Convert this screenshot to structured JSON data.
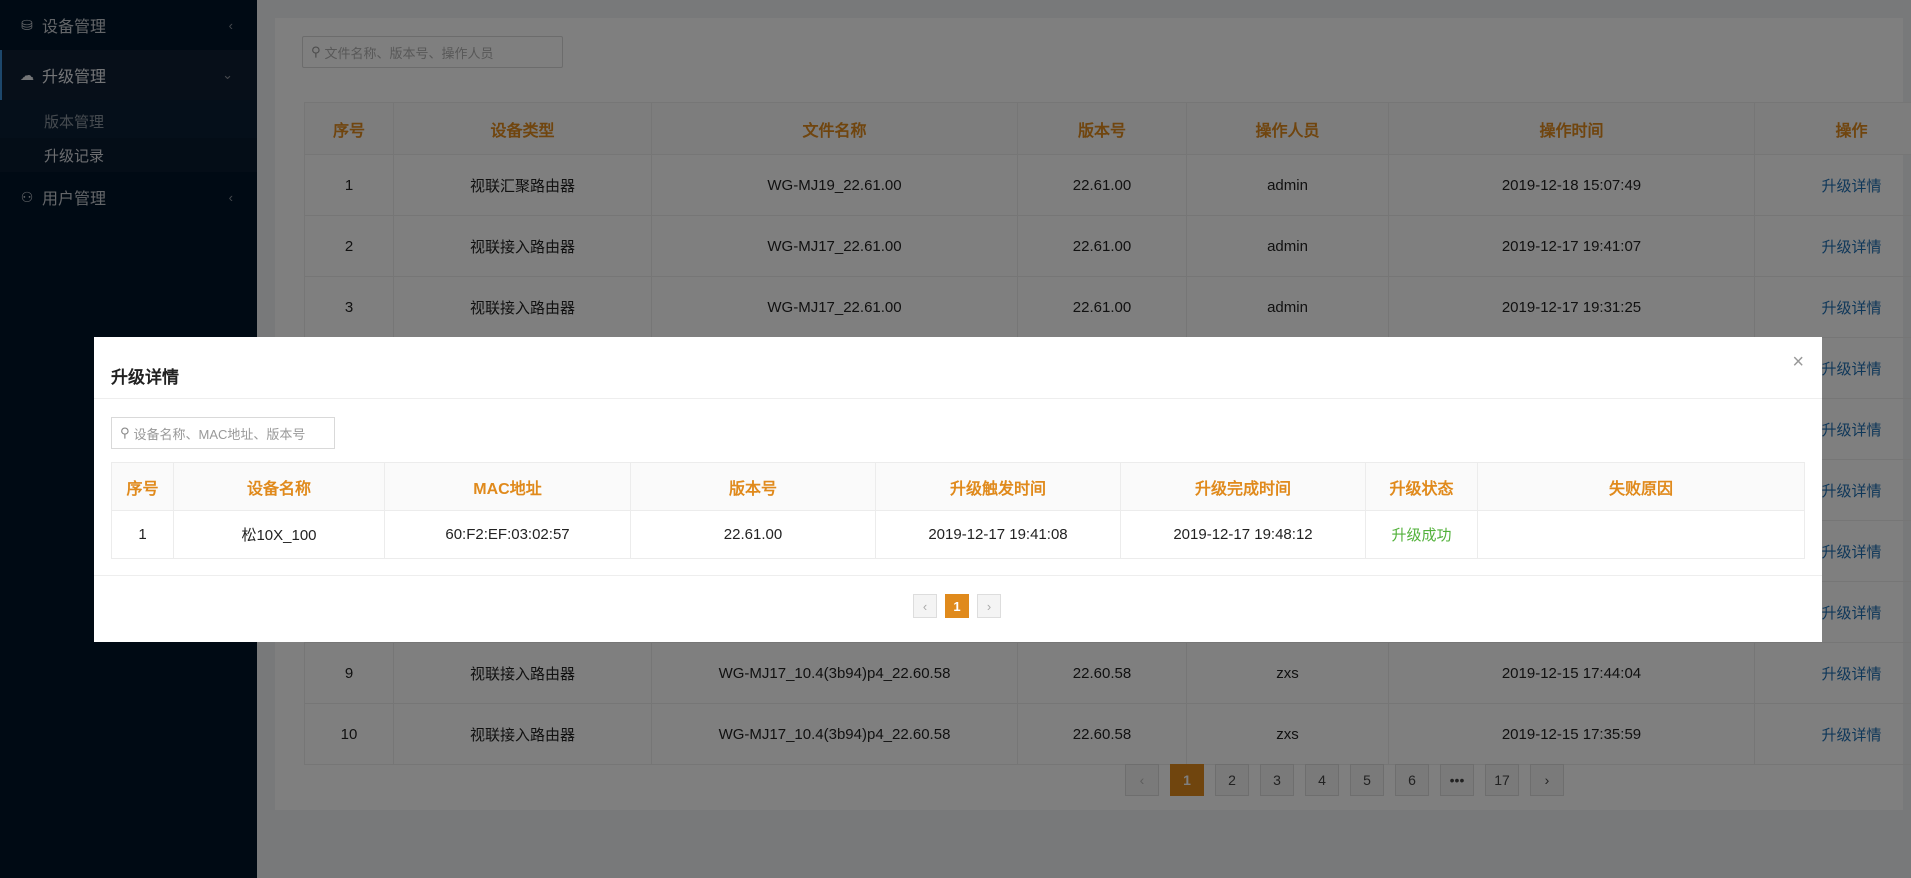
{
  "sidebar": {
    "items": [
      {
        "label": "设备管理",
        "icon": "device-icon"
      },
      {
        "label": "升级管理",
        "icon": "cloud-upload-icon"
      },
      {
        "label": "用户管理",
        "icon": "user-edit-icon"
      }
    ],
    "sub_items": [
      {
        "label": "版本管理"
      },
      {
        "label": "升级记录"
      }
    ]
  },
  "main": {
    "search_placeholder": "文件名称、版本号、操作人员",
    "columns": [
      "序号",
      "设备类型",
      "文件名称",
      "版本号",
      "操作人员",
      "操作时间",
      "操作"
    ],
    "rows": [
      {
        "no": "1",
        "type": "视联汇聚路由器",
        "file": "WG-MJ19_22.61.00",
        "version": "22.61.00",
        "operator": "admin",
        "time": "2019-12-18 15:07:49",
        "action": "升级详情"
      },
      {
        "no": "2",
        "type": "视联接入路由器",
        "file": "WG-MJ17_22.61.00",
        "version": "22.61.00",
        "operator": "admin",
        "time": "2019-12-17 19:41:07",
        "action": "升级详情"
      },
      {
        "no": "3",
        "type": "视联接入路由器",
        "file": "WG-MJ17_22.61.00",
        "version": "22.61.00",
        "operator": "admin",
        "time": "2019-12-17 19:31:25",
        "action": "升级详情"
      },
      {
        "no": "",
        "type": "",
        "file": "",
        "version": "",
        "operator": "",
        "time": "",
        "action": "升级详情"
      },
      {
        "no": "",
        "type": "",
        "file": "",
        "version": "",
        "operator": "",
        "time": "",
        "action": "升级详情"
      },
      {
        "no": "",
        "type": "",
        "file": "",
        "version": "",
        "operator": "",
        "time": "",
        "action": "升级详情"
      },
      {
        "no": "",
        "type": "",
        "file": "",
        "version": "",
        "operator": "",
        "time": "",
        "action": "升级详情"
      },
      {
        "no": "",
        "type": "",
        "file": "",
        "version": "",
        "operator": "",
        "time": "",
        "action": "升级详情"
      },
      {
        "no": "9",
        "type": "视联接入路由器",
        "file": "WG-MJ17_10.4(3b94)p4_22.60.58",
        "version": "22.60.58",
        "operator": "zxs",
        "time": "2019-12-15 17:44:04",
        "action": "升级详情"
      },
      {
        "no": "10",
        "type": "视联接入路由器",
        "file": "WG-MJ17_10.4(3b94)p4_22.60.58",
        "version": "22.60.58",
        "operator": "zxs",
        "time": "2019-12-15 17:35:59",
        "action": "升级详情"
      }
    ],
    "pagination": {
      "prev": "‹",
      "pages": [
        "1",
        "2",
        "3",
        "4",
        "5",
        "6",
        "•••",
        "17"
      ],
      "current": "1",
      "next": "›"
    }
  },
  "modal": {
    "title": "升级详情",
    "close": "×",
    "search_placeholder": "设备名称、MAC地址、版本号",
    "columns": [
      "序号",
      "设备名称",
      "MAC地址",
      "版本号",
      "升级触发时间",
      "升级完成时间",
      "升级状态",
      "失败原因"
    ],
    "rows": [
      {
        "no": "1",
        "name": "松10X_100",
        "mac": "60:F2:EF:03:02:57",
        "version": "22.61.00",
        "trigger_time": "2019-12-17 19:41:08",
        "done_time": "2019-12-17 19:48:12",
        "status": "升级成功",
        "reason": ""
      }
    ],
    "pagination": {
      "prev": "‹",
      "current": "1",
      "next": "›"
    }
  },
  "colors": {
    "accent": "#e08a1c",
    "link": "#1f6fb3",
    "success": "#52b13a",
    "sidebar_bg": "#001529"
  }
}
